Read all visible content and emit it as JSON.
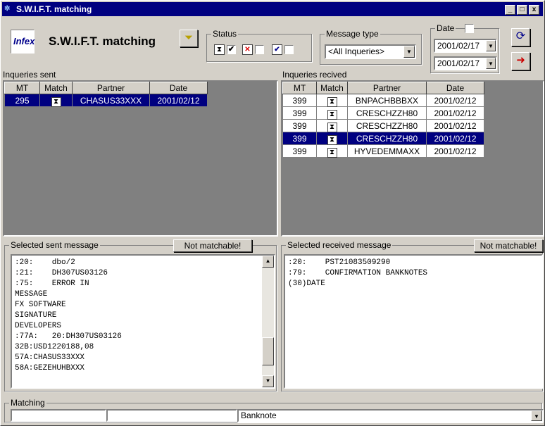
{
  "window": {
    "title": "S.W.I.F.T. matching",
    "controls": [
      "_",
      "□",
      "x"
    ]
  },
  "header": {
    "logo_text": "Infex",
    "app_title": "S.W.I.F.T. matching"
  },
  "status": {
    "label": "Status"
  },
  "message_type": {
    "label": "Message type",
    "selected": "<All Inqueries>"
  },
  "date": {
    "label": "Date",
    "from": "2001/02/17",
    "to": "2001/02/17"
  },
  "sent": {
    "label": "Inqueries sent",
    "columns": [
      "MT",
      "Match",
      "Partner",
      "Date"
    ],
    "rows": [
      {
        "mt": "295",
        "partner": "CHASUS33XXX",
        "date": "2001/02/12",
        "selected": true
      }
    ]
  },
  "received": {
    "label": "Inqueries recived",
    "columns": [
      "MT",
      "Match",
      "Partner",
      "Date"
    ],
    "rows": [
      {
        "mt": "399",
        "partner": "BNPACHBBBXX",
        "date": "2001/02/12",
        "selected": false
      },
      {
        "mt": "399",
        "partner": "CRESCHZZH80",
        "date": "2001/02/12",
        "selected": false
      },
      {
        "mt": "399",
        "partner": "CRESCHZZH80",
        "date": "2001/02/12",
        "selected": false
      },
      {
        "mt": "399",
        "partner": "CRESCHZZH80",
        "date": "2001/02/12",
        "selected": true
      },
      {
        "mt": "399",
        "partner": "HYVEDEMMAXX",
        "date": "2001/02/12",
        "selected": false
      }
    ]
  },
  "sent_message": {
    "label": "Selected sent message",
    "button": "Not matchable!",
    "lines": [
      ":20:    dbo/2",
      ":21:    DH307US03126",
      ":75:    ERROR IN",
      "MESSAGE",
      "FX SOFTWARE",
      "SIGNATURE",
      "DEVELOPERS",
      ":77A:   20:DH307US03126",
      "32B:USD1220188,08",
      "57A:CHASUS33XXX",
      "58A:GEZEHUHBXXX"
    ]
  },
  "received_message": {
    "label": "Selected received message",
    "button": "Not matchable!",
    "lines": [
      ":20:    PST21083509290",
      ":79:    CONFIRMATION BANKNOTES",
      "(30)DATE"
    ]
  },
  "matching": {
    "label": "Matching",
    "field1": "",
    "field2": "",
    "combo_value": "Banknote"
  },
  "icons": {
    "filter": "filter-funnel-icon",
    "refresh": "refresh-icon",
    "exit": "exit-door-icon",
    "hourglass": "hourglass-icon"
  }
}
